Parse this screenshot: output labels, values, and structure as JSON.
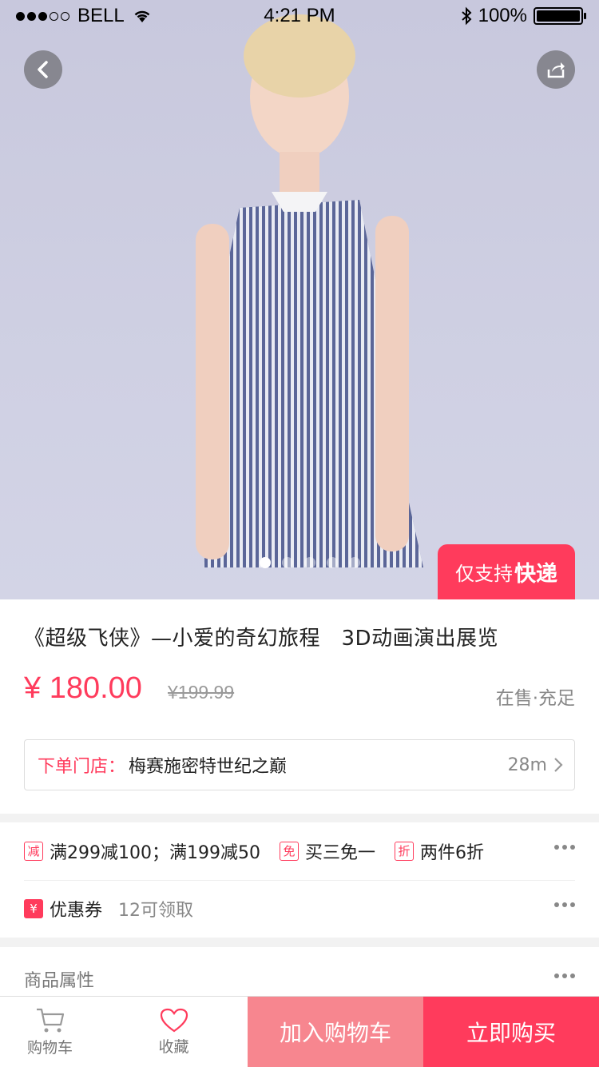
{
  "status_bar": {
    "carrier": "BELL",
    "time": "4:21 PM",
    "battery": "100%"
  },
  "hero": {
    "express_prefix": "仅支持",
    "express_highlight": "快递",
    "page_count": 5,
    "active_page": 1
  },
  "product": {
    "title": "《超级飞侠》—小爱的奇幻旅程　3D动画演出展览",
    "price": "¥ 180.00",
    "original_price": "¥199.99",
    "stock_status": "在售·充足",
    "store": {
      "label": "下单门店：",
      "name": "梅赛施密特世纪之巅",
      "distance": "28m"
    }
  },
  "promotions": {
    "items": [
      {
        "tag": "减",
        "text": "满299减100；满199减50"
      },
      {
        "tag": "免",
        "text": "买三免一"
      },
      {
        "tag": "折",
        "text": "两件6折"
      }
    ],
    "coupon": {
      "tag": "¥",
      "label": "优惠券",
      "count": "12可领取"
    }
  },
  "attributes": {
    "label": "商品属性"
  },
  "bottom_bar": {
    "cart_label": "购物车",
    "favorite_label": "收藏",
    "add_to_cart": "加入购物车",
    "buy_now": "立即购买"
  },
  "colors": {
    "accent": "#ff3b5c",
    "accent_light": "#f7868f"
  }
}
